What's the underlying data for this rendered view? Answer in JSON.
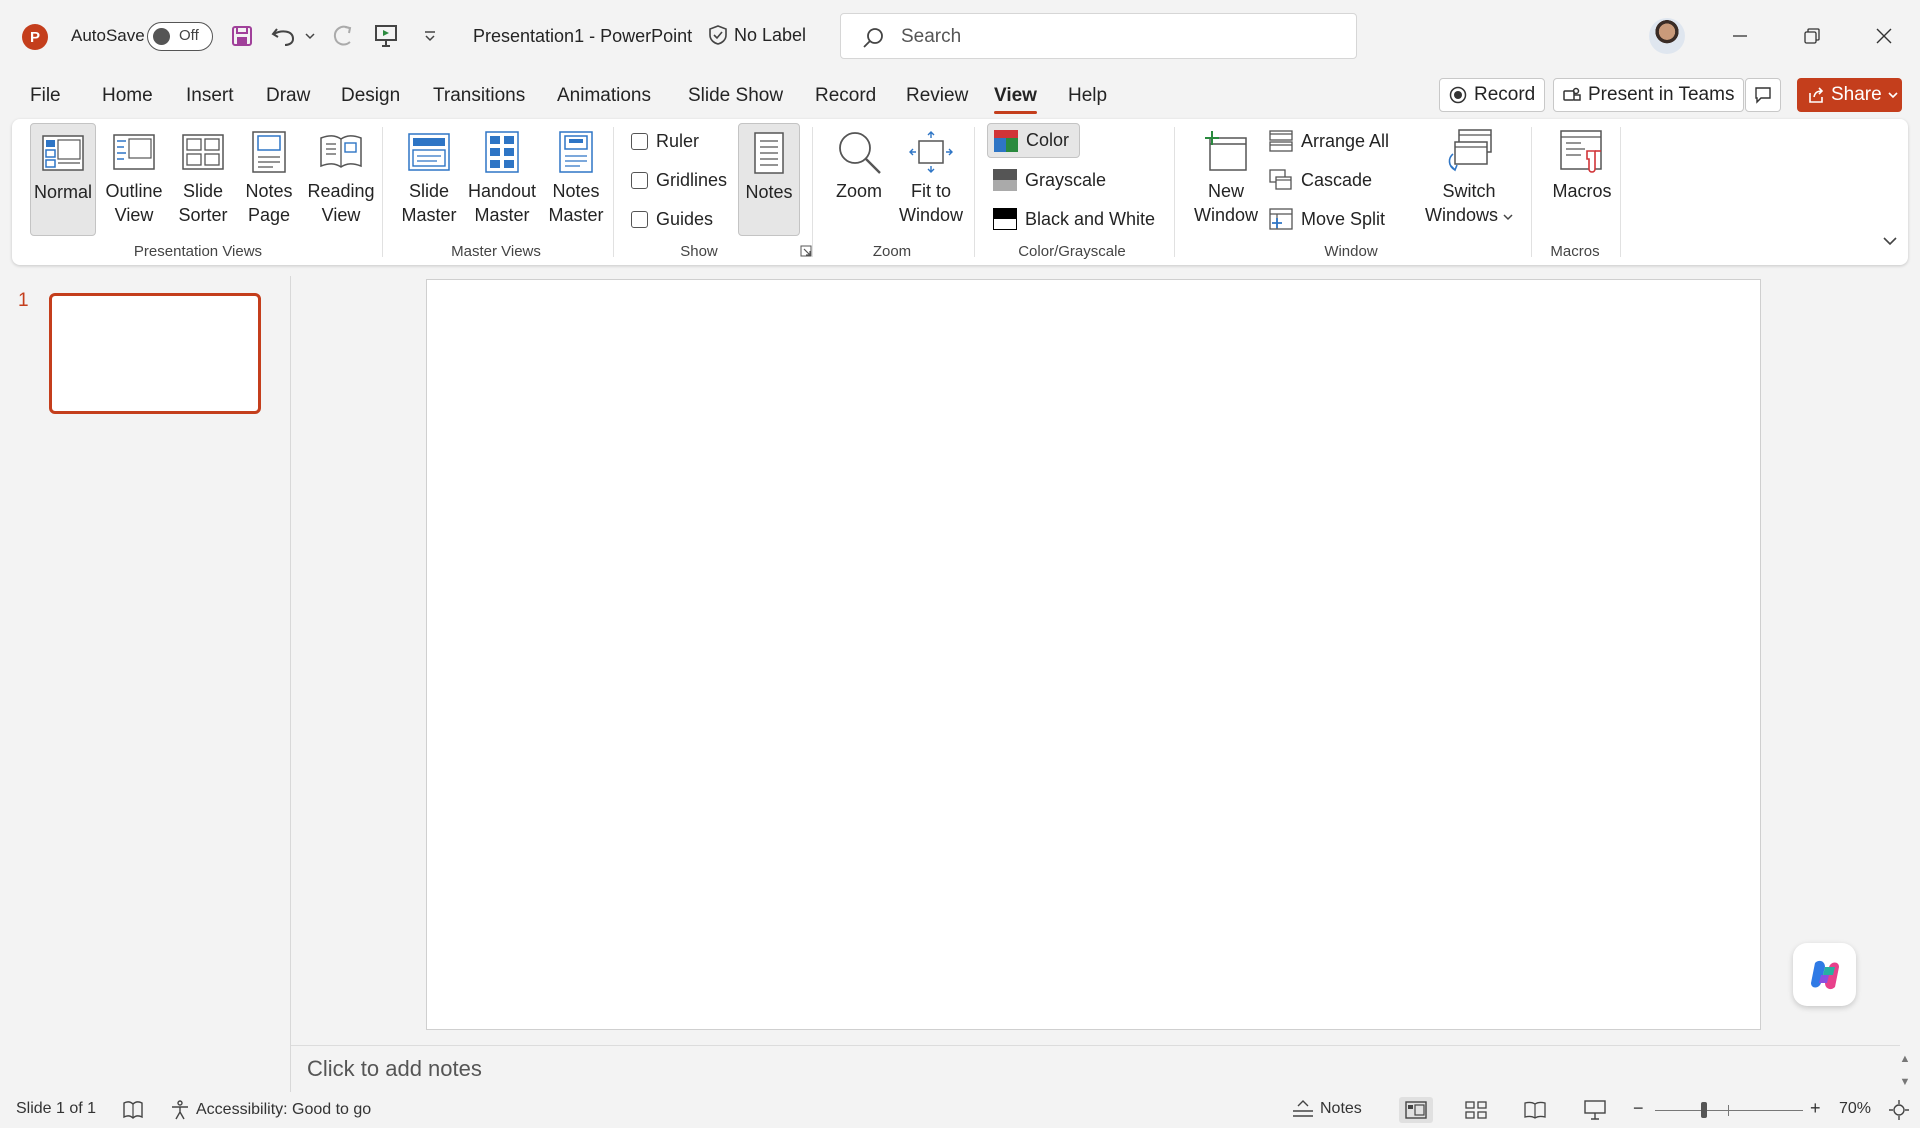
{
  "titlebar": {
    "app_initial": "P",
    "autosave_label": "AutoSave",
    "autosave_state": "Off",
    "doc_title": "Presentation1  -  PowerPoint",
    "sensitivity_label": "No Label",
    "search_placeholder": "Search"
  },
  "tabs": [
    "File",
    "Home",
    "Insert",
    "Draw",
    "Design",
    "Transitions",
    "Animations",
    "Slide Show",
    "Record",
    "Review",
    "View",
    "Help"
  ],
  "active_tab": "View",
  "top_actions": {
    "record": "Record",
    "present_in_teams": "Present in Teams",
    "share": "Share"
  },
  "ribbon": {
    "presentation_views": {
      "label": "Presentation Views",
      "normal": [
        "Normal",
        ""
      ],
      "outline": [
        "Outline",
        "View"
      ],
      "sorter": [
        "Slide",
        "Sorter"
      ],
      "notes_page": [
        "Notes",
        "Page"
      ],
      "reading": [
        "Reading",
        "View"
      ]
    },
    "master_views": {
      "label": "Master Views",
      "slide_master": [
        "Slide",
        "Master"
      ],
      "handout_master": [
        "Handout",
        "Master"
      ],
      "notes_master": [
        "Notes",
        "Master"
      ]
    },
    "show": {
      "label": "Show",
      "ruler": "Ruler",
      "gridlines": "Gridlines",
      "guides": "Guides",
      "notes": "Notes"
    },
    "zoom": {
      "label": "Zoom",
      "zoom": "Zoom",
      "fit": [
        "Fit to",
        "Window"
      ]
    },
    "color_grayscale": {
      "label": "Color/Grayscale",
      "color": "Color",
      "grayscale": "Grayscale",
      "bw": "Black and White"
    },
    "window": {
      "label": "Window",
      "new_window": [
        "New",
        "Window"
      ],
      "arrange_all": "Arrange All",
      "cascade": "Cascade",
      "move_split": "Move Split",
      "switch_windows": [
        "Switch",
        "Windows"
      ]
    },
    "macros": {
      "label": "Macros",
      "macros": "Macros"
    }
  },
  "thumbnails": {
    "slide_number": "1"
  },
  "notes_placeholder": "Click to add notes",
  "status": {
    "slide_info": "Slide 1 of 1",
    "accessibility": "Accessibility: Good to go",
    "notes": "Notes",
    "zoom": "70%"
  },
  "colors": {
    "accent": "#c43e1c",
    "selected_bg": "#e6e6e6"
  }
}
